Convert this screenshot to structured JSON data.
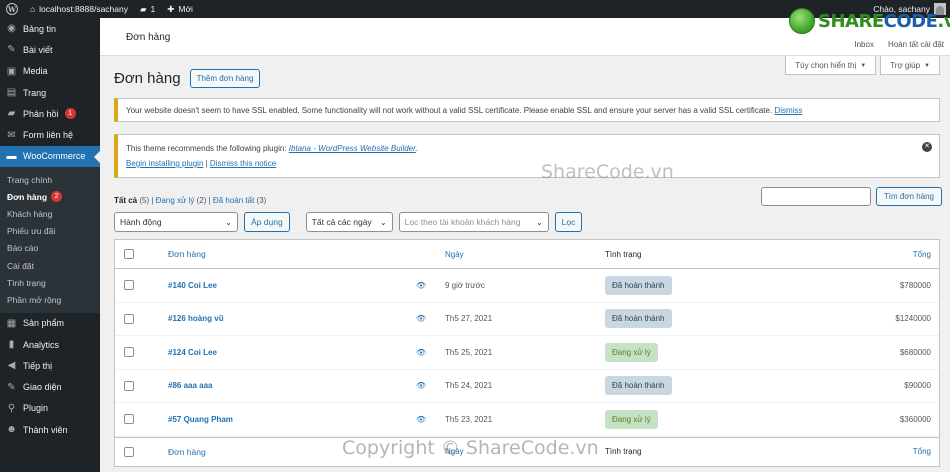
{
  "adminbar": {
    "site_url": "localhost:8888/sachany",
    "comments_count": "1",
    "new_label": "Mới",
    "greeting": "Chào, sachany"
  },
  "sidebar": {
    "items_top": [
      {
        "label": "Bảng tin",
        "icon": "dashboard-icon",
        "glyph": "◉"
      },
      {
        "label": "Bài viết",
        "icon": "pin-icon",
        "glyph": "✎"
      },
      {
        "label": "Media",
        "icon": "media-icon",
        "glyph": "▣"
      },
      {
        "label": "Trang",
        "icon": "page-icon",
        "glyph": "▤"
      },
      {
        "label": "Phản hồi",
        "icon": "comment-icon",
        "glyph": "▰",
        "badge": "1"
      },
      {
        "label": "Form liên hệ",
        "icon": "mail-icon",
        "glyph": "✉"
      }
    ],
    "woocommerce": {
      "label": "WooCommerce",
      "icon": "woocommerce-icon",
      "glyph": "▬"
    },
    "submenu": [
      {
        "label": "Trang chính"
      },
      {
        "label": "Đơn hàng",
        "badge": "2",
        "current": true
      },
      {
        "label": "Khách hàng"
      },
      {
        "label": "Phiếu ưu đãi"
      },
      {
        "label": "Báo cáo"
      },
      {
        "label": "Cài đặt"
      },
      {
        "label": "Tình trạng"
      },
      {
        "label": "Phần mở rộng"
      }
    ],
    "items_bottom": [
      {
        "label": "Sản phẩm",
        "icon": "products-icon",
        "glyph": "▦"
      },
      {
        "label": "Analytics",
        "icon": "analytics-icon",
        "glyph": "▮"
      },
      {
        "label": "Tiếp thị",
        "icon": "megaphone-icon",
        "glyph": "◀"
      },
      {
        "label": "Giao diện",
        "icon": "appearance-icon",
        "glyph": "✎"
      },
      {
        "label": "Plugin",
        "icon": "plugin-icon",
        "glyph": "⚲"
      },
      {
        "label": "Thành viên",
        "icon": "users-icon",
        "glyph": "☻"
      }
    ]
  },
  "header": {
    "breadcrumb": "Đơn hàng",
    "inbox": "Inbox",
    "finish_setup": "Hoàn tất cài đặt"
  },
  "screen_options": {
    "label": "Tùy chọn hiển thị",
    "help": "Trợ giúp"
  },
  "page": {
    "title": "Đơn hàng",
    "add_new": "Thêm đơn hàng"
  },
  "notices": {
    "ssl_text": "Your website doesn't seem to have SSL enabled. Some functionality will not work without a valid SSL certificate. Please enable SSL and ensure your server has a valid SSL certificate.",
    "ssl_dismiss": "Dismiss",
    "theme_text": "This theme recommends the following plugin:",
    "theme_plugin": "Ibtana - WordPress Website Builder",
    "theme_begin": "Begin installing plugin",
    "theme_dismiss": "Dismiss this notice"
  },
  "filters": {
    "all": "Tất cả",
    "all_count": "(5)",
    "processing": "Đang xử lý",
    "processing_count": "(2)",
    "completed": "Đã hoàn tất",
    "completed_count": "(3)",
    "bulk_action": "Hành động",
    "apply": "Áp dụng",
    "all_dates": "Tất cả các ngày",
    "customer_placeholder": "Lọc theo tài khoản khách hàng",
    "filter": "Lọc",
    "search_button": "Tìm đơn hàng"
  },
  "table": {
    "columns": {
      "order": "Đơn hàng",
      "date": "Ngày",
      "status": "Tình trạng",
      "total": "Tổng"
    },
    "rows": [
      {
        "order": "#140 Coi Lee",
        "date": "9 giờ trước",
        "status": "Đã hoàn thành",
        "status_type": "completed",
        "total": "$780000"
      },
      {
        "order": "#126 hoàng vũ",
        "date": "Th5 27, 2021",
        "status": "Đã hoàn thành",
        "status_type": "completed",
        "total": "$1240000"
      },
      {
        "order": "#124 Coi Lee",
        "date": "Th5 25, 2021",
        "status": "Đang xử lý",
        "status_type": "processing",
        "total": "$680000"
      },
      {
        "order": "#86 aaa aaa",
        "date": "Th5 24, 2021",
        "status": "Đã hoàn thành",
        "status_type": "completed",
        "total": "$90000"
      },
      {
        "order": "#57 Quang Pham",
        "date": "Th5 23, 2021",
        "status": "Đang xử lý",
        "status_type": "processing",
        "total": "$360000"
      }
    ]
  },
  "watermarks": {
    "logo_share": "SHARE",
    "logo_code": "CODE",
    "logo_tld": ".vn",
    "middle": "ShareCode.vn",
    "bottom": "Copyright © ShareCode.vn"
  },
  "colors": {
    "accent": "#2271b1",
    "adminbar": "#1d2327",
    "completed_bg": "#c8d7e1",
    "processing_bg": "#c6e1c6",
    "badge": "#d63638"
  }
}
